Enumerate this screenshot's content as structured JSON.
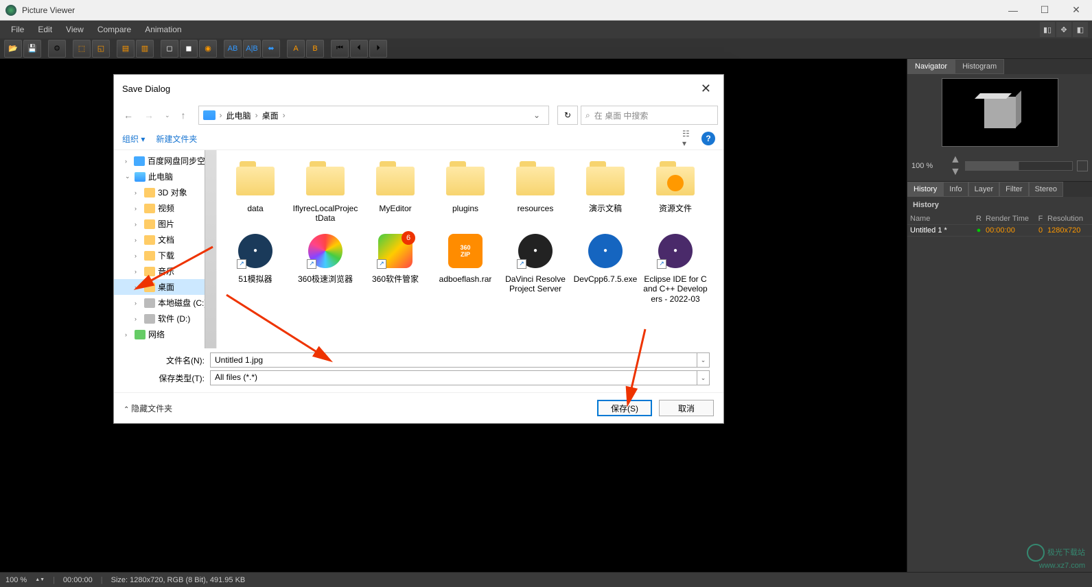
{
  "app": {
    "title": "Picture Viewer"
  },
  "window_controls": {
    "minimize": "—",
    "maximize": "☐",
    "close": "✕"
  },
  "menu": {
    "items": [
      "File",
      "Edit",
      "View",
      "Compare",
      "Animation"
    ]
  },
  "right_panel": {
    "nav_tabs": [
      "Navigator",
      "Histogram"
    ],
    "zoom": "100 %",
    "history_tabs": [
      "History",
      "Info",
      "Layer",
      "Filter",
      "Stereo"
    ],
    "history_header": "History",
    "history_columns": {
      "name": "Name",
      "r": "R",
      "time": "Render Time",
      "f": "F",
      "res": "Resolution"
    },
    "history_rows": [
      {
        "name": "Untitled 1 *",
        "r": "●",
        "time": "00:00:00",
        "f": "0",
        "res": "1280x720"
      }
    ]
  },
  "statusbar": {
    "zoom": "100 %",
    "time": "00:00:00",
    "size": "Size: 1280x720, RGB (8 Bit), 491.95 KB"
  },
  "dialog": {
    "title": "Save Dialog",
    "nav": {
      "breadcrumb": [
        "此电脑",
        "桌面"
      ],
      "refresh": "↻",
      "search_placeholder": "在 桌面 中搜索"
    },
    "toolbar": {
      "organize": "组织",
      "new_folder": "新建文件夹"
    },
    "tree": [
      {
        "indent": 1,
        "expand": "›",
        "icon": "cloud",
        "label": "百度网盘同步空间",
        "selected": false
      },
      {
        "indent": 1,
        "expand": "⌄",
        "icon": "pc",
        "label": "此电脑",
        "selected": false
      },
      {
        "indent": 2,
        "expand": "›",
        "icon": "folder-ic",
        "label": "3D 对象",
        "selected": false
      },
      {
        "indent": 2,
        "expand": "›",
        "icon": "folder-ic",
        "label": "视频",
        "selected": false
      },
      {
        "indent": 2,
        "expand": "›",
        "icon": "folder-ic",
        "label": "图片",
        "selected": false
      },
      {
        "indent": 2,
        "expand": "›",
        "icon": "folder-ic",
        "label": "文档",
        "selected": false
      },
      {
        "indent": 2,
        "expand": "›",
        "icon": "folder-ic",
        "label": "下载",
        "selected": false
      },
      {
        "indent": 2,
        "expand": "›",
        "icon": "folder-ic",
        "label": "音乐",
        "selected": false
      },
      {
        "indent": 2,
        "expand": "›",
        "icon": "folder-ic",
        "label": "桌面",
        "selected": true
      },
      {
        "indent": 2,
        "expand": "›",
        "icon": "disk",
        "label": "本地磁盘 (C:)",
        "selected": false
      },
      {
        "indent": 2,
        "expand": "›",
        "icon": "disk",
        "label": "软件 (D:)",
        "selected": false
      },
      {
        "indent": 1,
        "expand": "›",
        "icon": "net",
        "label": "网络",
        "selected": false
      }
    ],
    "files": [
      {
        "label": "data",
        "type": "folder"
      },
      {
        "label": "IflyrecLocalProjectData",
        "type": "folder"
      },
      {
        "label": "MyEditor",
        "type": "folder"
      },
      {
        "label": "plugins",
        "type": "folder"
      },
      {
        "label": "resources",
        "type": "folder"
      },
      {
        "label": "演示文稿",
        "type": "folder"
      },
      {
        "label": "资源文件",
        "type": "folder-special"
      },
      {
        "label": "51模拟器",
        "type": "app",
        "shortcut": true,
        "color": "#1a3a5a"
      },
      {
        "label": "360极速浏览器",
        "type": "app",
        "shortcut": true,
        "color": "mixed"
      },
      {
        "label": "360软件管家",
        "type": "app",
        "shortcut": true,
        "color": "green",
        "badge": "6"
      },
      {
        "label": "adboeflash.rar",
        "type": "archive",
        "color": "#ff8c00"
      },
      {
        "label": "DaVinci Resolve Project Server",
        "type": "app",
        "shortcut": true,
        "color": "#222"
      },
      {
        "label": "DevCpp6.7.5.exe",
        "type": "app",
        "color": "#1565c0"
      },
      {
        "label": "Eclipse IDE for C and C++ Developers - 2022-03",
        "type": "app",
        "shortcut": true,
        "color": "#4a2a6a"
      }
    ],
    "fields": {
      "filename_label": "文件名(N):",
      "filename_value": "Untitled 1.jpg",
      "filetype_label": "保存类型(T):",
      "filetype_value": "All files (*.*)"
    },
    "footer": {
      "hide_folders": "隐藏文件夹",
      "save": "保存(S)",
      "cancel": "取消"
    }
  },
  "watermark": {
    "line1": "极光下载站",
    "line2": "www.xz7.com"
  }
}
